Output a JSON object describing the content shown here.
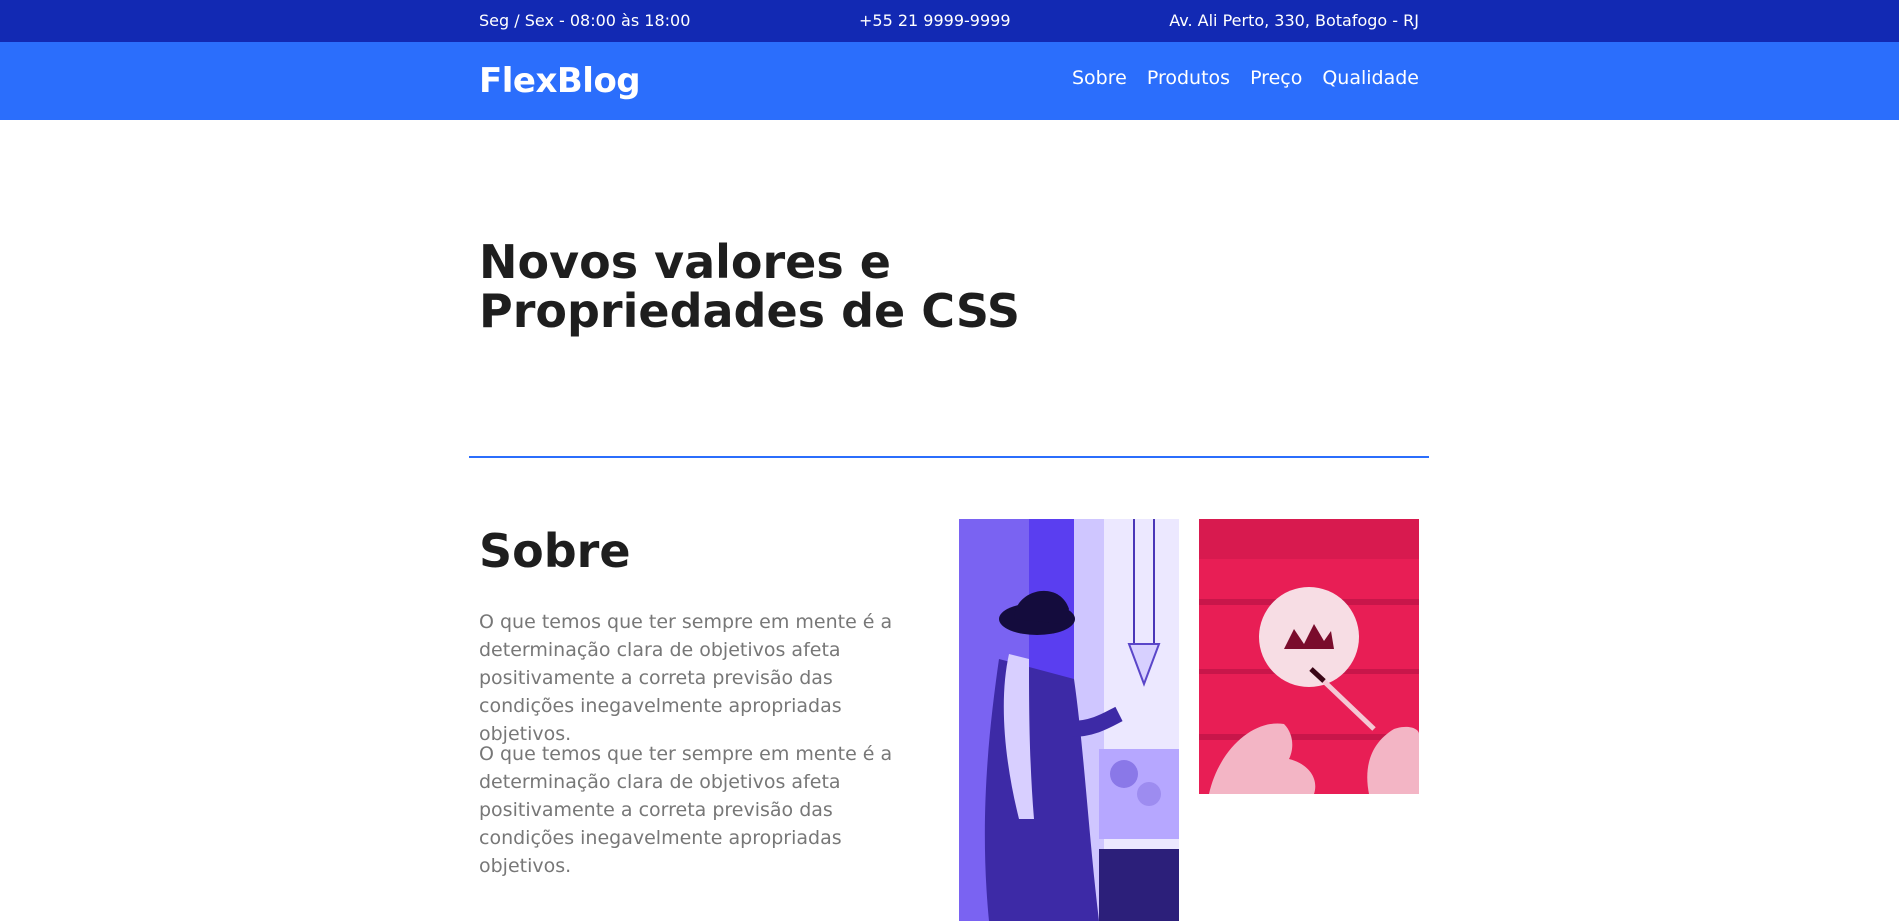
{
  "topbar": {
    "hours": "Seg / Sex - 08:00 às 18:00",
    "phone": "+55 21 9999-9999",
    "address": "Av. Ali Perto, 330, Botafogo - RJ"
  },
  "navbar": {
    "logo": "FlexBlog",
    "links": [
      "Sobre",
      "Produtos",
      "Preço",
      "Qualidade"
    ]
  },
  "hero": {
    "title_line1": "Novos valores e",
    "title_line2": "Propriedades de CSS"
  },
  "about": {
    "title": "Sobre",
    "paragraphs": [
      "O que temos que ter sempre em mente é a determinação clara de objetivos afeta positivamente a correta previsão das condições inegavelmente apropriadas objetivos.",
      "O que temos que ter sempre em mente é a determinação clara de objetivos afeta positivamente a correta previsão das condições inegavelmente apropriadas objetivos."
    ]
  },
  "colors": {
    "topbar": "#1229b3",
    "navbar": "#2b6efc",
    "accent": "#2b6efc",
    "heading": "#1e1e1e",
    "body_text": "#777777",
    "photo_purple": "#5a3ef0",
    "photo_red": "#e81e55"
  }
}
